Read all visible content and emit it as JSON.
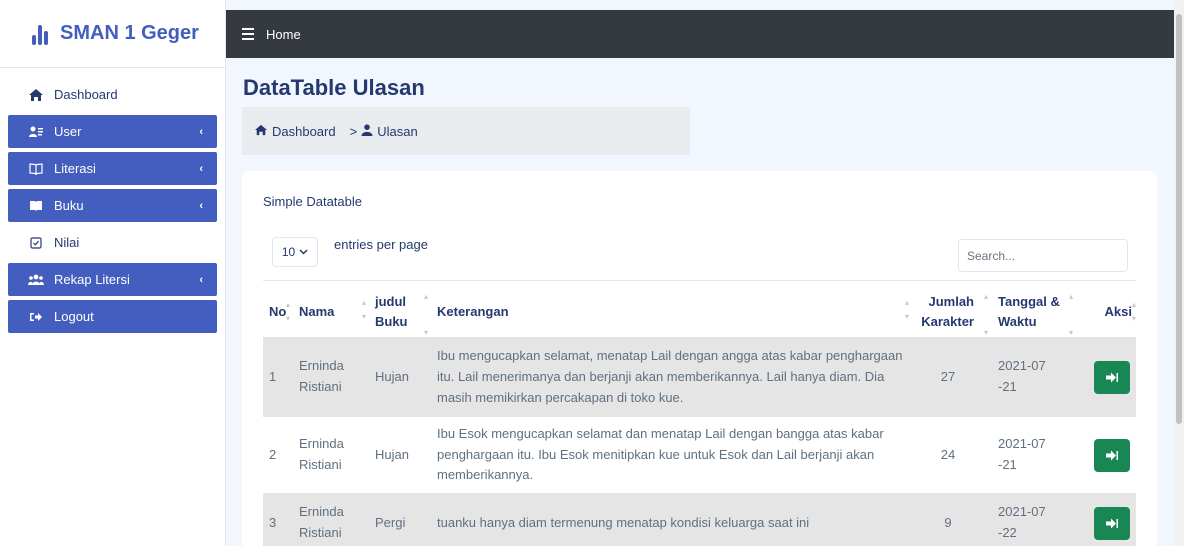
{
  "brand": {
    "title": "SMAN 1 Geger",
    "icon": "bar-chart-logo-icon"
  },
  "sidebar": {
    "items": [
      {
        "label": "Dashboard",
        "icon": "home-icon",
        "active": false
      },
      {
        "label": "User",
        "icon": "user-list-icon",
        "active": true,
        "chevron": "‹"
      },
      {
        "label": "Literasi",
        "icon": "open-book-icon",
        "active": true,
        "chevron": "‹"
      },
      {
        "label": "Buku",
        "icon": "book-icon",
        "active": true,
        "chevron": "‹"
      },
      {
        "label": "Nilai",
        "icon": "checkbox-icon",
        "active": false
      },
      {
        "label": "Rekap Litersi",
        "icon": "users-group-icon",
        "active": true,
        "chevron": "‹"
      },
      {
        "label": "Logout",
        "icon": "sign-out-icon",
        "active": true
      }
    ]
  },
  "topbar": {
    "home_label": "Home"
  },
  "page": {
    "title": "DataTable Ulasan"
  },
  "breadcrumb": {
    "home": "Dashboard",
    "separator": ">",
    "current": "Ulasan"
  },
  "card": {
    "title": "Simple Datatable"
  },
  "controls": {
    "per_page_value": "10",
    "per_page_label": "entries per page",
    "search_placeholder": "Search..."
  },
  "table": {
    "headers": {
      "no": "No",
      "nama": "Nama",
      "judul_1": "judul",
      "judul_2": "Buku",
      "keterangan": "Keterangan",
      "jumlah_1": "Jumlah",
      "jumlah_2": "Karakter",
      "tanggal_1": "Tanggal &",
      "tanggal_2": "Waktu",
      "aksi": "Aksi"
    },
    "rows": [
      {
        "no": "1",
        "nama": "Erninda Ristiani",
        "judul": "Hujan",
        "keterangan": "Ibu mengucapkan selamat, menatap Lail dengan angga atas kabar penghargaan itu. Lail menerimanya dan berjanji akan memberikannya. Lail hanya diam. Dia masih memikirkan percakapan di toko kue.",
        "jumlah": "27",
        "tanggal": "2021-07-21"
      },
      {
        "no": "2",
        "nama": "Erninda Ristiani",
        "judul": "Hujan",
        "keterangan": "Ibu Esok mengucapkan selamat dan menatap Lail dengan bangga atas kabar penghargaan itu. Ibu Esok menitipkan kue untuk Esok dan Lail berjanji akan memberikannya.",
        "jumlah": "24",
        "tanggal": "2021-07-21"
      },
      {
        "no": "3",
        "nama": "Erninda Ristiani",
        "judul": "Pergi",
        "keterangan": "tuanku hanya diam termenung menatap kondisi keluarga saat ini",
        "jumlah": "9",
        "tanggal": "2021-07-22"
      }
    ],
    "action_icon": "sign-in-arrow-icon"
  },
  "colors": {
    "primary": "#435ebe",
    "topbar": "#343a40",
    "success": "#198754",
    "row_striped": "#e5e5e5"
  }
}
